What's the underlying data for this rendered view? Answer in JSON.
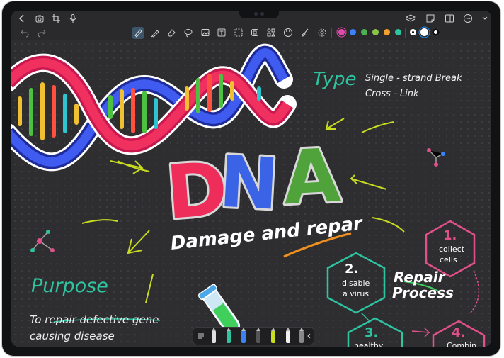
{
  "toolbar": {
    "icons": [
      "back-icon",
      "camera-icon",
      "crop-icon",
      "microphone-icon",
      "layers-icon",
      "note-icon",
      "split-view-icon",
      "more-icon",
      "chevron-down-icon"
    ],
    "tools": [
      "undo-icon",
      "redo-icon",
      "pen-icon",
      "highlighter-icon",
      "eraser-icon",
      "lasso-icon",
      "image-icon",
      "text-icon",
      "shape-icon",
      "sticker-icon",
      "layout-icon",
      "palette-icon",
      "brush-icon",
      "settings-icon"
    ],
    "colors": [
      "#e24aa8",
      "#3b82f6",
      "#4caf50",
      "#8bc34a",
      "#f0a030",
      "#2ec4a0"
    ],
    "accent": "#1d8ff0"
  },
  "canvas": {
    "title": "DNA",
    "subtitle_a": "Damage and ",
    "subtitle_b": "repar",
    "type_label": "Type",
    "type_line1": "Single - strand Break",
    "type_line2": "Cross - Link",
    "purpose_label": "Purpose",
    "purpose_line1": "To repair defective gene",
    "purpose_line2": "causing disease",
    "repair_line1": "Repair",
    "repair_line2": "Process",
    "step1_num": "1.",
    "step1_text1": "collect",
    "step1_text2": "cells",
    "step2_num": "2.",
    "step2_text1": "disable",
    "step2_text2": "a virus",
    "step3_num": "3.",
    "step3_text1": "healthy",
    "step4_num": "4.",
    "step4_text1": "Combin"
  },
  "pentray": {
    "icons": [
      "list-icon",
      "pencil-icon",
      "marker-icon",
      "pen-icon",
      "pen-icon",
      "highlighter-icon",
      "pencil-icon",
      "pen-icon",
      "chevron-left-icon"
    ]
  }
}
